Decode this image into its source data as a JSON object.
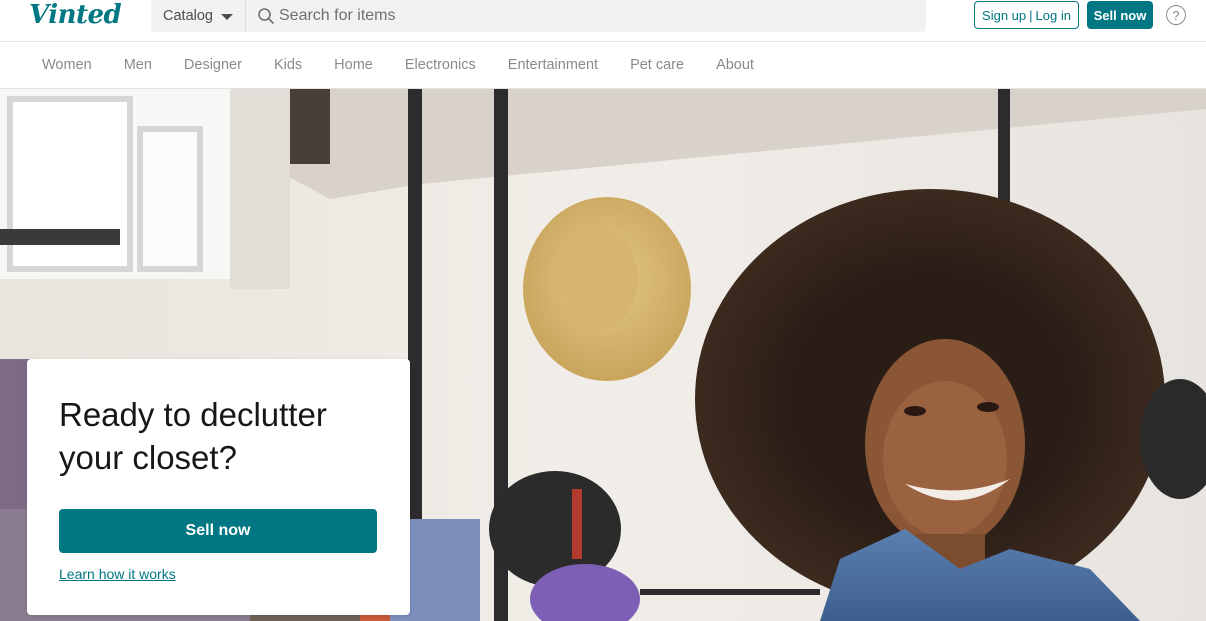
{
  "header": {
    "logo": "Vinted",
    "catalog_label": "Catalog",
    "search_placeholder": "Search for items",
    "signup_label": "Sign up",
    "separator": "|",
    "login_label": "Log in",
    "sell_label": "Sell now",
    "help_symbol": "?"
  },
  "categories": [
    "Women",
    "Men",
    "Designer",
    "Kids",
    "Home",
    "Electronics",
    "Entertainment",
    "Pet care",
    "About"
  ],
  "hero": {
    "title": "Ready to declutter your closet?",
    "sell_button": "Sell now",
    "learn_link": "Learn how it works"
  },
  "colors": {
    "brand": "#007782",
    "muted_text": "#8a8a8a"
  },
  "icons": [
    "search-icon",
    "caret-down-icon",
    "help-icon"
  ]
}
